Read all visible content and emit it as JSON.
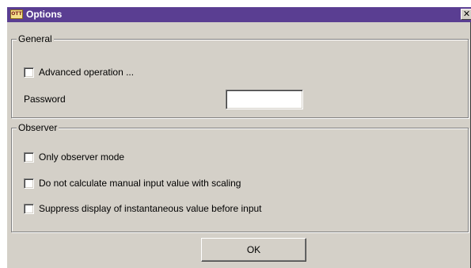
{
  "window": {
    "title": "Options",
    "app_icon_text": "OTT",
    "close_glyph": "✕",
    "title_color": "#5a3e92"
  },
  "general": {
    "legend": "General",
    "advanced_label": "Advanced operation ...",
    "advanced_checked": false,
    "password_label": "Password",
    "password_value": ""
  },
  "observer": {
    "legend": "Observer",
    "options": [
      {
        "label": "Only observer mode",
        "checked": false
      },
      {
        "label": "Do not calculate manual input value with scaling",
        "checked": false
      },
      {
        "label": "Suppress display of instantaneous value before input",
        "checked": false
      }
    ]
  },
  "buttons": {
    "ok_label": "OK"
  }
}
